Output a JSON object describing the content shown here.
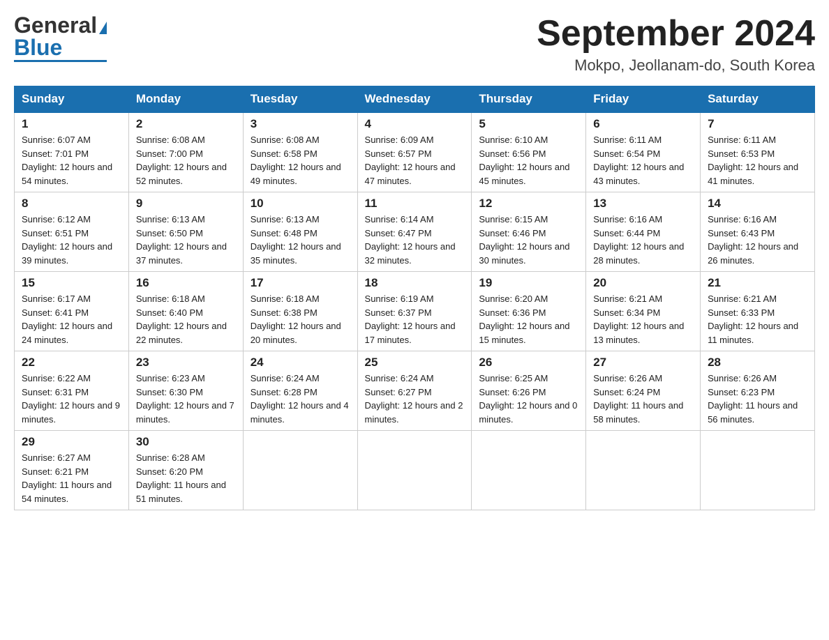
{
  "header": {
    "logo_general": "General",
    "logo_blue": "Blue",
    "month_title": "September 2024",
    "location": "Mokpo, Jeollanam-do, South Korea"
  },
  "days_of_week": [
    "Sunday",
    "Monday",
    "Tuesday",
    "Wednesday",
    "Thursday",
    "Friday",
    "Saturday"
  ],
  "weeks": [
    [
      {
        "day": "1",
        "sunrise": "6:07 AM",
        "sunset": "7:01 PM",
        "daylight": "12 hours and 54 minutes."
      },
      {
        "day": "2",
        "sunrise": "6:08 AM",
        "sunset": "7:00 PM",
        "daylight": "12 hours and 52 minutes."
      },
      {
        "day": "3",
        "sunrise": "6:08 AM",
        "sunset": "6:58 PM",
        "daylight": "12 hours and 49 minutes."
      },
      {
        "day": "4",
        "sunrise": "6:09 AM",
        "sunset": "6:57 PM",
        "daylight": "12 hours and 47 minutes."
      },
      {
        "day": "5",
        "sunrise": "6:10 AM",
        "sunset": "6:56 PM",
        "daylight": "12 hours and 45 minutes."
      },
      {
        "day": "6",
        "sunrise": "6:11 AM",
        "sunset": "6:54 PM",
        "daylight": "12 hours and 43 minutes."
      },
      {
        "day": "7",
        "sunrise": "6:11 AM",
        "sunset": "6:53 PM",
        "daylight": "12 hours and 41 minutes."
      }
    ],
    [
      {
        "day": "8",
        "sunrise": "6:12 AM",
        "sunset": "6:51 PM",
        "daylight": "12 hours and 39 minutes."
      },
      {
        "day": "9",
        "sunrise": "6:13 AM",
        "sunset": "6:50 PM",
        "daylight": "12 hours and 37 minutes."
      },
      {
        "day": "10",
        "sunrise": "6:13 AM",
        "sunset": "6:48 PM",
        "daylight": "12 hours and 35 minutes."
      },
      {
        "day": "11",
        "sunrise": "6:14 AM",
        "sunset": "6:47 PM",
        "daylight": "12 hours and 32 minutes."
      },
      {
        "day": "12",
        "sunrise": "6:15 AM",
        "sunset": "6:46 PM",
        "daylight": "12 hours and 30 minutes."
      },
      {
        "day": "13",
        "sunrise": "6:16 AM",
        "sunset": "6:44 PM",
        "daylight": "12 hours and 28 minutes."
      },
      {
        "day": "14",
        "sunrise": "6:16 AM",
        "sunset": "6:43 PM",
        "daylight": "12 hours and 26 minutes."
      }
    ],
    [
      {
        "day": "15",
        "sunrise": "6:17 AM",
        "sunset": "6:41 PM",
        "daylight": "12 hours and 24 minutes."
      },
      {
        "day": "16",
        "sunrise": "6:18 AM",
        "sunset": "6:40 PM",
        "daylight": "12 hours and 22 minutes."
      },
      {
        "day": "17",
        "sunrise": "6:18 AM",
        "sunset": "6:38 PM",
        "daylight": "12 hours and 20 minutes."
      },
      {
        "day": "18",
        "sunrise": "6:19 AM",
        "sunset": "6:37 PM",
        "daylight": "12 hours and 17 minutes."
      },
      {
        "day": "19",
        "sunrise": "6:20 AM",
        "sunset": "6:36 PM",
        "daylight": "12 hours and 15 minutes."
      },
      {
        "day": "20",
        "sunrise": "6:21 AM",
        "sunset": "6:34 PM",
        "daylight": "12 hours and 13 minutes."
      },
      {
        "day": "21",
        "sunrise": "6:21 AM",
        "sunset": "6:33 PM",
        "daylight": "12 hours and 11 minutes."
      }
    ],
    [
      {
        "day": "22",
        "sunrise": "6:22 AM",
        "sunset": "6:31 PM",
        "daylight": "12 hours and 9 minutes."
      },
      {
        "day": "23",
        "sunrise": "6:23 AM",
        "sunset": "6:30 PM",
        "daylight": "12 hours and 7 minutes."
      },
      {
        "day": "24",
        "sunrise": "6:24 AM",
        "sunset": "6:28 PM",
        "daylight": "12 hours and 4 minutes."
      },
      {
        "day": "25",
        "sunrise": "6:24 AM",
        "sunset": "6:27 PM",
        "daylight": "12 hours and 2 minutes."
      },
      {
        "day": "26",
        "sunrise": "6:25 AM",
        "sunset": "6:26 PM",
        "daylight": "12 hours and 0 minutes."
      },
      {
        "day": "27",
        "sunrise": "6:26 AM",
        "sunset": "6:24 PM",
        "daylight": "11 hours and 58 minutes."
      },
      {
        "day": "28",
        "sunrise": "6:26 AM",
        "sunset": "6:23 PM",
        "daylight": "11 hours and 56 minutes."
      }
    ],
    [
      {
        "day": "29",
        "sunrise": "6:27 AM",
        "sunset": "6:21 PM",
        "daylight": "11 hours and 54 minutes."
      },
      {
        "day": "30",
        "sunrise": "6:28 AM",
        "sunset": "6:20 PM",
        "daylight": "11 hours and 51 minutes."
      },
      {
        "day": "",
        "sunrise": "",
        "sunset": "",
        "daylight": ""
      },
      {
        "day": "",
        "sunrise": "",
        "sunset": "",
        "daylight": ""
      },
      {
        "day": "",
        "sunrise": "",
        "sunset": "",
        "daylight": ""
      },
      {
        "day": "",
        "sunrise": "",
        "sunset": "",
        "daylight": ""
      },
      {
        "day": "",
        "sunrise": "",
        "sunset": "",
        "daylight": ""
      }
    ]
  ]
}
